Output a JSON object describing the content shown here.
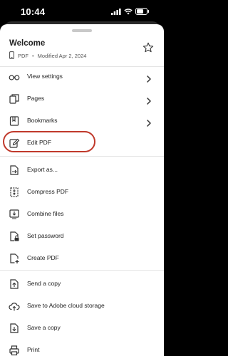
{
  "status_bar": {
    "time": "10:44",
    "icons": [
      "signal-icon",
      "wifi-icon",
      "battery-icon"
    ]
  },
  "document": {
    "title": "Welcome",
    "type": "PDF",
    "separator": "•",
    "modified": "Modified Apr 2, 2024",
    "favorite_icon": "star-outline-icon"
  },
  "menu": {
    "group1": [
      {
        "label": "View settings",
        "icon": "glasses-icon",
        "has_chevron": true
      },
      {
        "label": "Pages",
        "icon": "pages-icon",
        "has_chevron": true
      },
      {
        "label": "Bookmarks",
        "icon": "bookmark-icon",
        "has_chevron": true
      },
      {
        "label": "Edit PDF",
        "icon": "edit-icon",
        "has_chevron": false,
        "highlighted": true
      }
    ],
    "group2": [
      {
        "label": "Export as...",
        "icon": "export-icon"
      },
      {
        "label": "Compress PDF",
        "icon": "compress-icon"
      },
      {
        "label": "Combine files",
        "icon": "combine-icon"
      },
      {
        "label": "Set password",
        "icon": "lock-icon"
      },
      {
        "label": "Create PDF",
        "icon": "create-pdf-icon"
      }
    ],
    "group3": [
      {
        "label": "Send a copy",
        "icon": "send-copy-icon"
      },
      {
        "label": "Save to Adobe cloud storage",
        "icon": "cloud-upload-icon"
      },
      {
        "label": "Save a copy",
        "icon": "save-copy-icon"
      },
      {
        "label": "Print",
        "icon": "print-icon"
      }
    ]
  },
  "colors": {
    "highlight_ring": "#c0392b",
    "text": "#222222",
    "divider": "#e4e4e4"
  }
}
